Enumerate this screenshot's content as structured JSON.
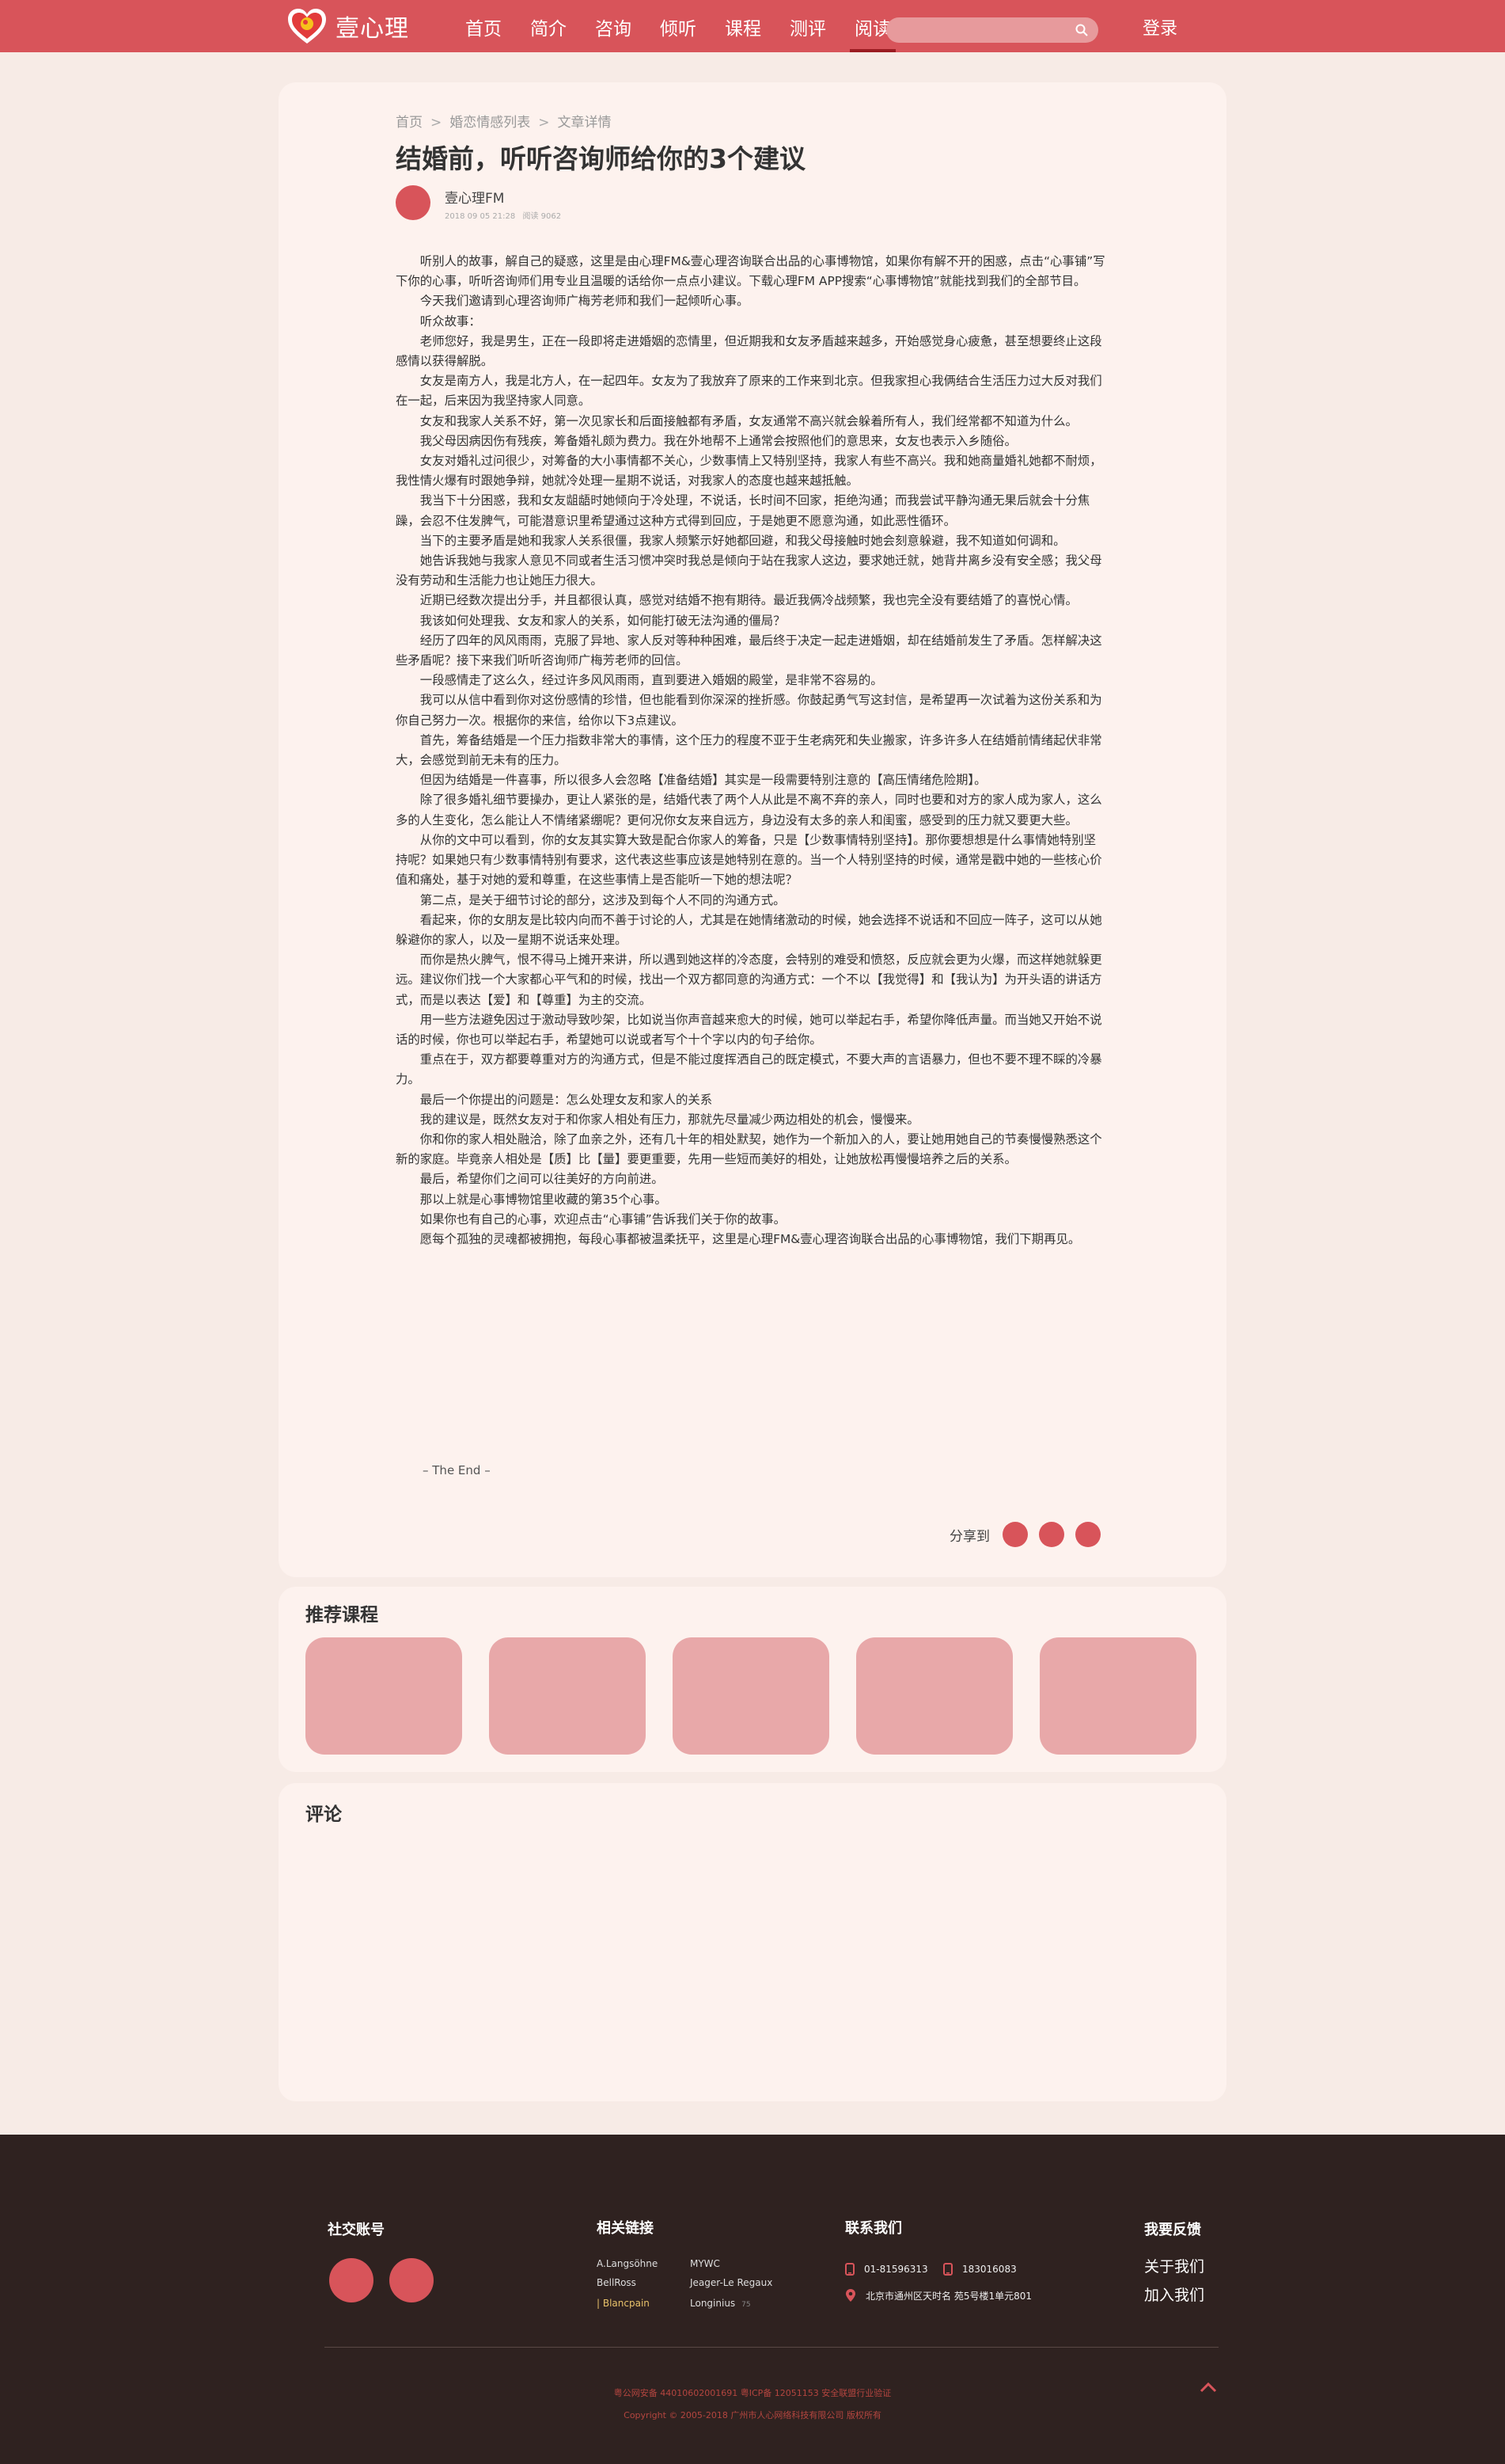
{
  "header": {
    "logo_text": "壹心理",
    "nav": [
      {
        "label": "首页"
      },
      {
        "label": "简介"
      },
      {
        "label": "咨询"
      },
      {
        "label": "倾听"
      },
      {
        "label": "课程"
      },
      {
        "label": "测评"
      },
      {
        "label": "阅读",
        "active": true
      }
    ],
    "search_placeholder": "",
    "login_label": "登录"
  },
  "breadcrumb": [
    "首页",
    "婚恋情感列表",
    "文章详情"
  ],
  "article": {
    "title": "结婚前，听听咨询师给你的3个建议",
    "author": "壹心理FM",
    "date": "2018 09 05 21:28",
    "reads": "阅读 9062",
    "paragraphs": [
      "听别人的故事，解自己的疑惑，这里是由心理FM&壹心理咨询联合出品的心事博物馆，如果你有解不开的困惑，点击“心事铺”写下你的心事，听听咨询师们用专业且温暖的话给你一点点小建议。下载心理FM APP搜索“心事博物馆”就能找到我们的全部节目。",
      "今天我们邀请到心理咨询师广梅芳老师和我们一起倾听心事。",
      "听众故事：",
      "老师您好，我是男生，正在一段即将走进婚姻的恋情里，但近期我和女友矛盾越来越多，开始感觉身心疲惫，甚至想要终止这段感情以获得解脱。",
      "女友是南方人，我是北方人，在一起四年。女友为了我放弃了原来的工作来到北京。但我家担心我俩结合生活压力过大反对我们在一起，后来因为我坚持家人同意。",
      "女友和我家人关系不好，第一次见家长和后面接触都有矛盾，女友通常不高兴就会躲着所有人，我们经常都不知道为什么。",
      "我父母因病因伤有残疾，筹备婚礼颇为费力。我在外地帮不上通常会按照他们的意思来，女友也表示入乡随俗。",
      "女友对婚礼过问很少，对筹备的大小事情都不关心，少数事情上又特别坚持，我家人有些不高兴。我和她商量婚礼她都不耐烦，我性情火爆有时跟她争辩，她就冷处理一星期不说话，对我家人的态度也越来越抵触。",
      "我当下十分困惑，我和女友龃龉时她倾向于冷处理，不说话，长时间不回家，拒绝沟通；而我尝试平静沟通无果后就会十分焦躁，会忍不住发脾气，可能潜意识里希望通过这种方式得到回应，于是她更不愿意沟通，如此恶性循环。",
      "当下的主要矛盾是她和我家人关系很僵，我家人频繁示好她都回避，和我父母接触时她会刻意躲避，我不知道如何调和。",
      "她告诉我她与我家人意见不同或者生活习惯冲突时我总是倾向于站在我家人这边，要求她迁就，她背井离乡没有安全感；我父母没有劳动和生活能力也让她压力很大。",
      "近期已经数次提出分手，并且都很认真，感觉对结婚不抱有期待。最近我俩冷战频繁，我也完全没有要结婚了的喜悦心情。",
      "我该如何处理我、女友和家人的关系，如何能打破无法沟通的僵局？",
      "经历了四年的风风雨雨，克服了异地、家人反对等种种困难，最后终于决定一起走进婚姻，却在结婚前发生了矛盾。怎样解决这些矛盾呢？接下来我们听听咨询师广梅芳老师的回信。",
      "一段感情走了这么久，经过许多风风雨雨，直到要进入婚姻的殿堂，是非常不容易的。",
      "我可以从信中看到你对这份感情的珍惜，但也能看到你深深的挫折感。你鼓起勇气写这封信，是希望再一次试着为这份关系和为你自己努力一次。根据你的来信，给你以下3点建议。",
      "首先，筹备结婚是一个压力指数非常大的事情，这个压力的程度不亚于生老病死和失业搬家，许多许多人在结婚前情绪起伏非常大，会感觉到前无未有的压力。",
      "但因为结婚是一件喜事，所以很多人会忽略【准备结婚】其实是一段需要特别注意的【高压情绪危险期】。",
      "除了很多婚礼细节要操办，更让人紧张的是，结婚代表了两个人从此是不离不弃的亲人，同时也要和对方的家人成为家人，这么多的人生变化，怎么能让人不情绪紧绷呢？更何况你女友来自远方，身边没有太多的亲人和闺蜜，感受到的压力就又要更大些。",
      "从你的文中可以看到，你的女友其实算大致是配合你家人的筹备，只是【少数事情特别坚持】。那你要想想是什么事情她特别坚持呢？如果她只有少数事情特别有要求，这代表这些事应该是她特别在意的。当一个人特别坚持的时候，通常是戳中她的一些核心价值和痛处，基于对她的爱和尊重，在这些事情上是否能听一下她的想法呢？",
      "第二点，是关于细节讨论的部分，这涉及到每个人不同的沟通方式。",
      "看起来，你的女朋友是比较内向而不善于讨论的人，尤其是在她情绪激动的时候，她会选择不说话和不回应一阵子，这可以从她躲避你的家人，以及一星期不说话来处理。",
      "而你是热火脾气，恨不得马上摊开来讲，所以遇到她这样的冷态度，会特别的难受和愤怒，反应就会更为火爆，而这样她就躲更远。建议你们找一个大家都心平气和的时候，找出一个双方都同意的沟通方式：一个不以【我觉得】和【我认为】为开头语的讲话方式，而是以表达【爱】和【尊重】为主的交流。",
      "用一些方法避免因过于激动导致吵架，比如说当你声音越来愈大的时候，她可以举起右手，希望你降低声量。而当她又开始不说话的时候，你也可以举起右手，希望她可以说或者写个十个字以内的句子给你。",
      "重点在于，双方都要尊重对方的沟通方式，但是不能过度挥洒自己的既定模式，不要大声的言语暴力，但也不要不理不睬的冷暴力。",
      "最后一个你提出的问题是：怎么处理女友和家人的关系",
      "我的建议是，既然女友对于和你家人相处有压力，那就先尽量减少两边相处的机会，慢慢来。",
      "你和你的家人相处融洽，除了血亲之外，还有几十年的相处默契，她作为一个新加入的人，要让她用她自己的节奏慢慢熟悉这个新的家庭。毕竟亲人相处是【质】比【量】要更重要，先用一些短而美好的相处，让她放松再慢慢培养之后的关系。",
      " 最后，希望你们之间可以往美好的方向前进。",
      "那以上就是心事博物馆里收藏的第35个心事。",
      "如果你也有自己的心事，欢迎点击“心事铺”告诉我们关于你的故事。",
      "愿每个孤独的灵魂都被拥抱，每段心事都被温柔抚平，这里是心理FM&壹心理咨询联合出品的心事博物馆，我们下期再见。"
    ],
    "the_end": "– The End –",
    "share_label": "分享到"
  },
  "courses": {
    "title": "推荐课程"
  },
  "comments": {
    "title": "评论"
  },
  "footer": {
    "social_title": "社交账号",
    "links_title": "相关链接",
    "links": [
      {
        "label": "A.Langsöhne"
      },
      {
        "label": "MYWC"
      },
      {
        "label": "BellRoss"
      },
      {
        "label": "Jeager-Le Regaux"
      },
      {
        "label": "Blancpain",
        "highlight": true
      },
      {
        "label": "Longinius",
        "extra": "75"
      }
    ],
    "contact_title": "联系我们",
    "phone1": "01-81596313",
    "phone2": "183016083",
    "address": "北京市通州区天时名  苑5号楼1单元801",
    "feedback_title": "我要反馈",
    "about": "关于我们",
    "join": "加入我们",
    "icp": "粤公网安备 44010602001691   粤ICP备 12051153  安全联盟行业验证",
    "copyright": "Copyright © 2005-2018 广州市人心网络科技有限公司 版权所有"
  },
  "colors": {
    "brand": "#d8545a",
    "card": "#e8a8a9",
    "footer": "#2f2220",
    "panel": "#fdf2ee"
  }
}
